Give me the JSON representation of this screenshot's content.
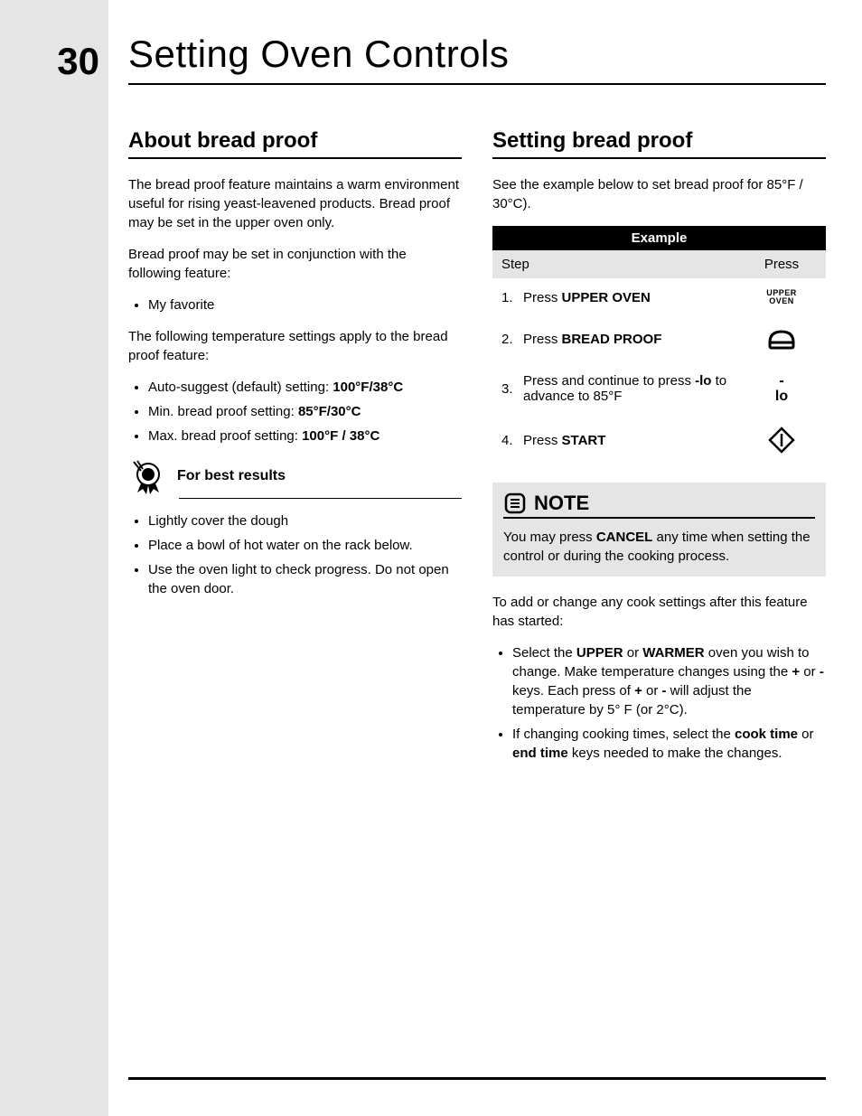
{
  "page_number": "30",
  "page_title": "Setting Oven Controls",
  "left": {
    "heading": "About bread proof",
    "p1": "The bread proof feature maintains a warm environment useful for rising yeast-leavened products. Bread proof may be set in the upper oven only.",
    "p2": "Bread proof may be set in conjunction with the following feature:",
    "conj_items": [
      "My favorite"
    ],
    "p3": "The following temperature settings apply to the bread proof feature:",
    "temp_items_pre": [
      "Auto-suggest (default) setting: ",
      "Min. bread proof setting: ",
      "Max. bread proof setting: "
    ],
    "temp_items_bold": [
      "100°F/38°C",
      "85°F/30°C",
      "100°F / 38°C"
    ],
    "best_results_title": "For best results",
    "best_results_items": [
      "Lightly cover the dough",
      "Place a bowl of hot water on the rack below.",
      "Use the oven light to check progress. Do not open the oven door."
    ]
  },
  "right": {
    "heading": "Setting bread proof",
    "intro_a": "See the example below to set bread proof for ",
    "intro_b": "85°F / 30°C",
    "intro_c": ").",
    "table_title": "Example",
    "col_step": "Step",
    "col_press": "Press",
    "rows": [
      {
        "n": "1.",
        "pre": "Press ",
        "bold": "UPPER OVEN",
        "post": ""
      },
      {
        "n": "2.",
        "pre": "Press ",
        "bold": "BREAD PROOF",
        "post": ""
      },
      {
        "n": "3.",
        "pre": "Press and continue to press ",
        "bold": "-lo",
        "post": " to advance to 85°F"
      },
      {
        "n": "4.",
        "pre": "Press ",
        "bold": "START",
        "post": ""
      }
    ],
    "press_upper_oven": "UPPER\nOVEN",
    "press_minus": "-",
    "press_lo": "lo",
    "note_title": "NOTE",
    "note_body_a": "You may press ",
    "note_body_b": "CANCEL",
    "note_body_c": " any time when setting the control or during the cooking process.",
    "after_p": "To add or change any cook settings after this feature has started:",
    "after_items": [
      {
        "segments": [
          {
            "t": "Select the ",
            "b": false
          },
          {
            "t": "UPPER",
            "b": true
          },
          {
            "t": " or ",
            "b": false
          },
          {
            "t": "WARMER",
            "b": true
          },
          {
            "t": " oven you wish to change. Make temperature changes using the ",
            "b": false
          },
          {
            "t": "+",
            "b": true
          },
          {
            "t": " or ",
            "b": false
          },
          {
            "t": "-",
            "b": true
          },
          {
            "t": " keys. Each press of ",
            "b": false
          },
          {
            "t": "+",
            "b": true
          },
          {
            "t": " or ",
            "b": false
          },
          {
            "t": "-",
            "b": true
          },
          {
            "t": " will adjust the temperature by 5° F (or 2°C).",
            "b": false
          }
        ]
      },
      {
        "segments": [
          {
            "t": "If changing cooking times, select the ",
            "b": false
          },
          {
            "t": "cook time",
            "b": true
          },
          {
            "t": " or ",
            "b": false
          },
          {
            "t": "end time",
            "b": true
          },
          {
            "t": " keys needed to make the changes.",
            "b": false
          }
        ]
      }
    ]
  }
}
